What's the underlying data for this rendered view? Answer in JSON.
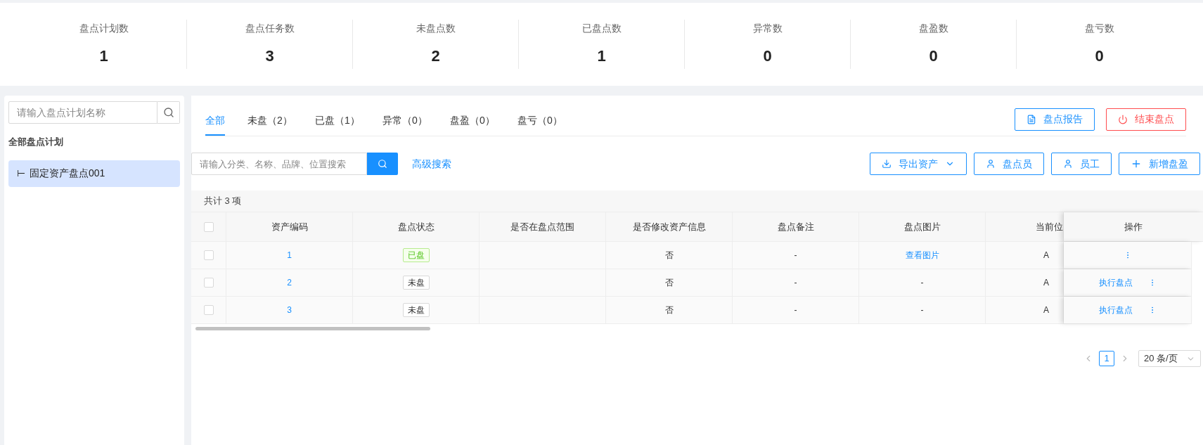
{
  "stats": [
    {
      "label": "盘点计划数",
      "value": "1"
    },
    {
      "label": "盘点任务数",
      "value": "3"
    },
    {
      "label": "未盘点数",
      "value": "2"
    },
    {
      "label": "已盘点数",
      "value": "1"
    },
    {
      "label": "异常数",
      "value": "0"
    },
    {
      "label": "盘盈数",
      "value": "0"
    },
    {
      "label": "盘亏数",
      "value": "0"
    }
  ],
  "sidebar": {
    "search": {
      "placeholder": "请输入盘点计划名称"
    },
    "heading": "全部盘点计划",
    "items": [
      {
        "marker": "⊢",
        "label": "固定资产盘点001",
        "selected": true
      }
    ]
  },
  "tabs": [
    {
      "label": "全部",
      "selected": true
    },
    {
      "label": "未盘（2）",
      "selected": false
    },
    {
      "label": "已盘（1）",
      "selected": false
    },
    {
      "label": "异常（0）",
      "selected": false
    },
    {
      "label": "盘盈（0）",
      "selected": false
    },
    {
      "label": "盘亏（0）",
      "selected": false
    }
  ],
  "top_buttons": [
    {
      "kind": "report",
      "label": "盘点报告"
    },
    {
      "kind": "end",
      "label": "结束盘点"
    }
  ],
  "search": {
    "placeholder": "请输入分类、名称、品牌、位置搜索",
    "advanced": "高级搜索"
  },
  "toolbar": [
    {
      "kind": "export",
      "label": "导出资产"
    },
    {
      "kind": "user",
      "label": "盘点员"
    },
    {
      "kind": "user",
      "label": "员工"
    },
    {
      "kind": "add",
      "label": "新增盘盈"
    }
  ],
  "table": {
    "total": "共计 3 项",
    "select_all_checked": false,
    "columns": [
      "资产编码",
      "盘点状态",
      "是否在盘点范围",
      "是否修改资产信息",
      "盘点备注",
      "盘点图片",
      "当前位",
      "操作"
    ],
    "rows": [
      {
        "checked": false,
        "code": "1",
        "status": {
          "kind": "done",
          "label": "已盘"
        },
        "in_scope": "",
        "modified": "否",
        "remark": "-",
        "image": {
          "text": "查看图片",
          "link": true
        },
        "location": "A",
        "action": ""
      },
      {
        "checked": false,
        "code": "2",
        "status": {
          "kind": "pending",
          "label": "未盘"
        },
        "in_scope": "",
        "modified": "否",
        "remark": "-",
        "image": {
          "text": "-",
          "link": false
        },
        "location": "A",
        "action": "执行盘点"
      },
      {
        "checked": false,
        "code": "3",
        "status": {
          "kind": "pending",
          "label": "未盘"
        },
        "in_scope": "",
        "modified": "否",
        "remark": "-",
        "image": {
          "text": "-",
          "link": false
        },
        "location": "A",
        "action": "执行盘点"
      }
    ]
  },
  "pagination": {
    "pages": [
      {
        "label": "1",
        "selected": true
      }
    ],
    "page_size": "20 条/页"
  }
}
